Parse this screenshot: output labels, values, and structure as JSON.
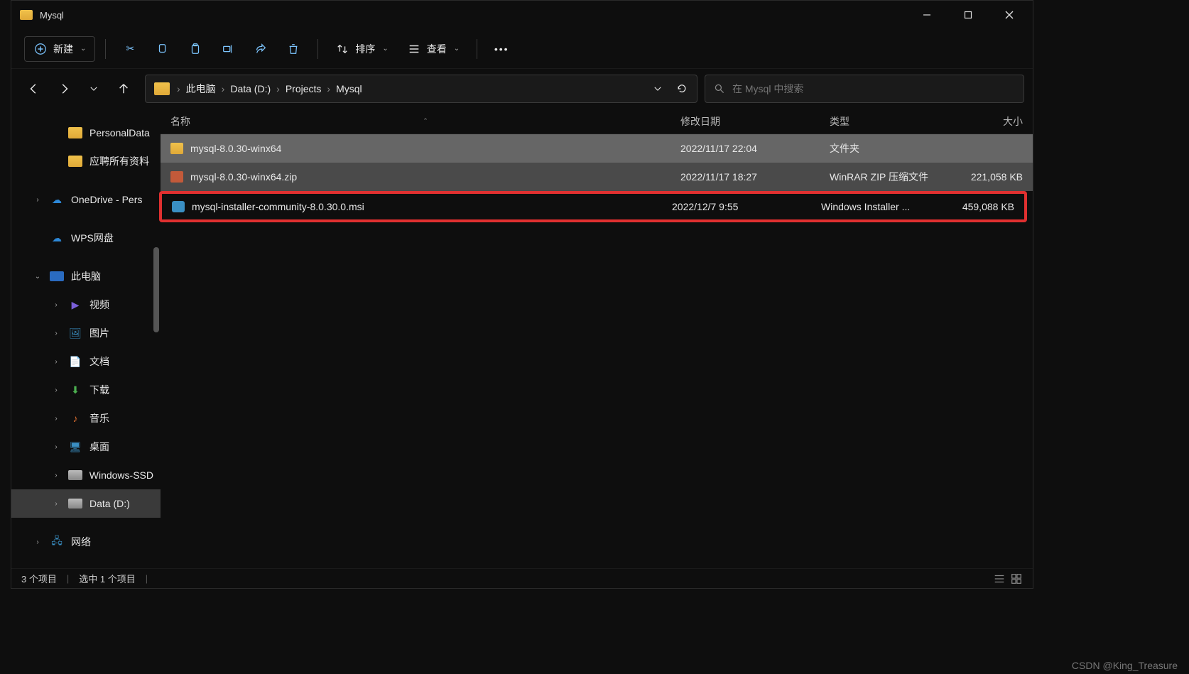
{
  "title": "Mysql",
  "toolbar": {
    "new_label": "新建",
    "sort_label": "排序",
    "view_label": "查看"
  },
  "breadcrumbs": [
    "此电脑",
    "Data (D:)",
    "Projects",
    "Mysql"
  ],
  "search": {
    "placeholder": "在 Mysql 中搜索"
  },
  "columns": {
    "name": "名称",
    "date": "修改日期",
    "type": "类型",
    "size": "大小"
  },
  "sidebar": {
    "items": [
      {
        "label": "PersonalData",
        "icon": "folder",
        "indent": 2
      },
      {
        "label": "应聘所有资料",
        "icon": "folder",
        "indent": 2
      },
      {
        "label": "OneDrive - Pers",
        "icon": "cloud",
        "indent": 1,
        "chev": "right"
      },
      {
        "label": "WPS网盘",
        "icon": "cloud",
        "indent": 1
      },
      {
        "label": "此电脑",
        "icon": "pc",
        "indent": 1,
        "chev": "down"
      },
      {
        "label": "视频",
        "icon": "video",
        "indent": 2,
        "chev": "right"
      },
      {
        "label": "图片",
        "icon": "image",
        "indent": 2,
        "chev": "right"
      },
      {
        "label": "文档",
        "icon": "doc",
        "indent": 2,
        "chev": "right"
      },
      {
        "label": "下载",
        "icon": "download",
        "indent": 2,
        "chev": "right"
      },
      {
        "label": "音乐",
        "icon": "music",
        "indent": 2,
        "chev": "right"
      },
      {
        "label": "桌面",
        "icon": "desktop",
        "indent": 2,
        "chev": "right"
      },
      {
        "label": "Windows-SSD",
        "icon": "drive",
        "indent": 2,
        "chev": "right"
      },
      {
        "label": "Data (D:)",
        "icon": "drive",
        "indent": 2,
        "chev": "right",
        "selected": true
      },
      {
        "label": "网络",
        "icon": "network",
        "indent": 1,
        "chev": "right"
      }
    ]
  },
  "files": [
    {
      "name": "mysql-8.0.30-winx64",
      "date": "2022/11/17 22:04",
      "type": "文件夹",
      "size": "",
      "icon": "folder",
      "selected": true
    },
    {
      "name": "mysql-8.0.30-winx64.zip",
      "date": "2022/11/17 18:27",
      "type": "WinRAR ZIP 压缩文件",
      "size": "221,058 KB",
      "icon": "zip",
      "sel2": true
    },
    {
      "name": "mysql-installer-community-8.0.30.0.msi",
      "date": "2022/12/7 9:55",
      "type": "Windows Installer ...",
      "size": "459,088 KB",
      "icon": "msi",
      "highlighted": true
    }
  ],
  "status": {
    "count": "3 个项目",
    "selected": "选中 1 个项目"
  },
  "watermark": "CSDN @King_Treasure"
}
